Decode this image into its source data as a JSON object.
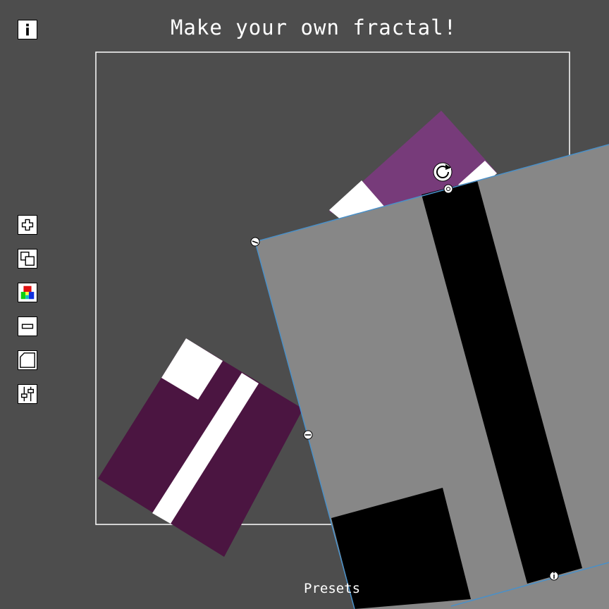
{
  "app": {
    "title": "Make your own fractal!"
  },
  "toolbar": {
    "info_icon": "info-icon",
    "tools": [
      {
        "name": "add-shape",
        "icon": "plus-icon"
      },
      {
        "name": "duplicate-shape",
        "icon": "duplicate-icon"
      },
      {
        "name": "color-palette",
        "icon": "palette-icon"
      },
      {
        "name": "remove-shape",
        "icon": "minus-icon"
      },
      {
        "name": "frame-shape",
        "icon": "frame-icon"
      },
      {
        "name": "settings-sliders",
        "icon": "sliders-icon"
      }
    ]
  },
  "footer": {
    "presets_label": "Presets"
  },
  "colors": {
    "background": "#4d4d4d",
    "frame": "#ffffff",
    "selected_outline": "#4a90c8",
    "shape_grey": "#878787",
    "shape_purple": "#773b7a",
    "shape_dark_purple": "#4b1541",
    "white": "#ffffff",
    "black": "#000000"
  },
  "handles": {
    "rotate": "rotate-handle-icon",
    "corner": "resize-handle-icon",
    "info": "info-handle-icon"
  }
}
